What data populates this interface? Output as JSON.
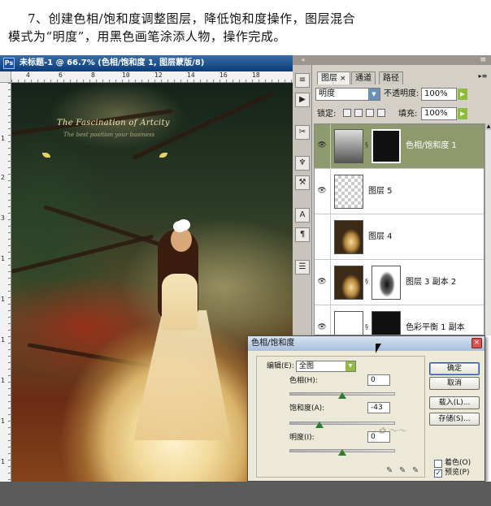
{
  "caption": {
    "line1": "7、创建色相/饱和度调整图层，降低饱和度操作，图层混合",
    "line2": "模式为“明度”，用黑色画笔涂添人物，操作完成。"
  },
  "document": {
    "title": "未标题-1 @ 66.7% (色相/饱和度 1, 图层蒙版/8)",
    "ruler_left_labels": [
      "1",
      "2",
      "3",
      "1",
      "1",
      "1",
      "1",
      "1",
      "1"
    ],
    "ruler_top_labels": [
      "4",
      "6",
      "8",
      "10",
      "12",
      "14",
      "16",
      "18"
    ],
    "artwork_title": "The Fascination of Artcity",
    "artwork_subtitle": "The best position your business"
  },
  "panel": {
    "tabs": [
      {
        "label": "图层",
        "close": "×",
        "active": true
      },
      {
        "label": "通道",
        "active": false
      },
      {
        "label": "路径",
        "active": false
      }
    ],
    "blend_mode": "明度",
    "opacity_label": "不透明度:",
    "opacity_value": "100%",
    "lock_label": "锁定:",
    "fill_label": "填充:",
    "fill_value": "100%",
    "layers": [
      {
        "name": "色相/饱和度 1",
        "selected": true
      },
      {
        "name": "图层 5",
        "selected": false
      },
      {
        "name": "图层 4",
        "selected": false
      },
      {
        "name": "图层 3 副本 2",
        "selected": false
      },
      {
        "name": "色彩平衡 1 副本",
        "selected": false
      }
    ],
    "tools": [
      "≡",
      "▶",
      "✂",
      "♆",
      "⚒",
      "A",
      "¶",
      "☰"
    ]
  },
  "dialog": {
    "title": "色相/饱和度",
    "edit_label": "编辑(E):",
    "edit_value": "全图",
    "hue_label": "色相(H):",
    "hue_value": "0",
    "saturation_label": "饱和度(A):",
    "saturation_value": "-43",
    "lightness_label": "明度(I):",
    "lightness_value": "0",
    "buttons": {
      "ok": "确定",
      "cancel": "取消",
      "load": "载入(L)...",
      "save": "存储(S)..."
    },
    "colorize_label": "着色(O)",
    "colorize_checked": false,
    "preview_label": "预览(P)",
    "preview_checked": true,
    "slider_positions": {
      "hue": 0.5,
      "saturation": 0.285,
      "lightness": 0.5
    }
  }
}
